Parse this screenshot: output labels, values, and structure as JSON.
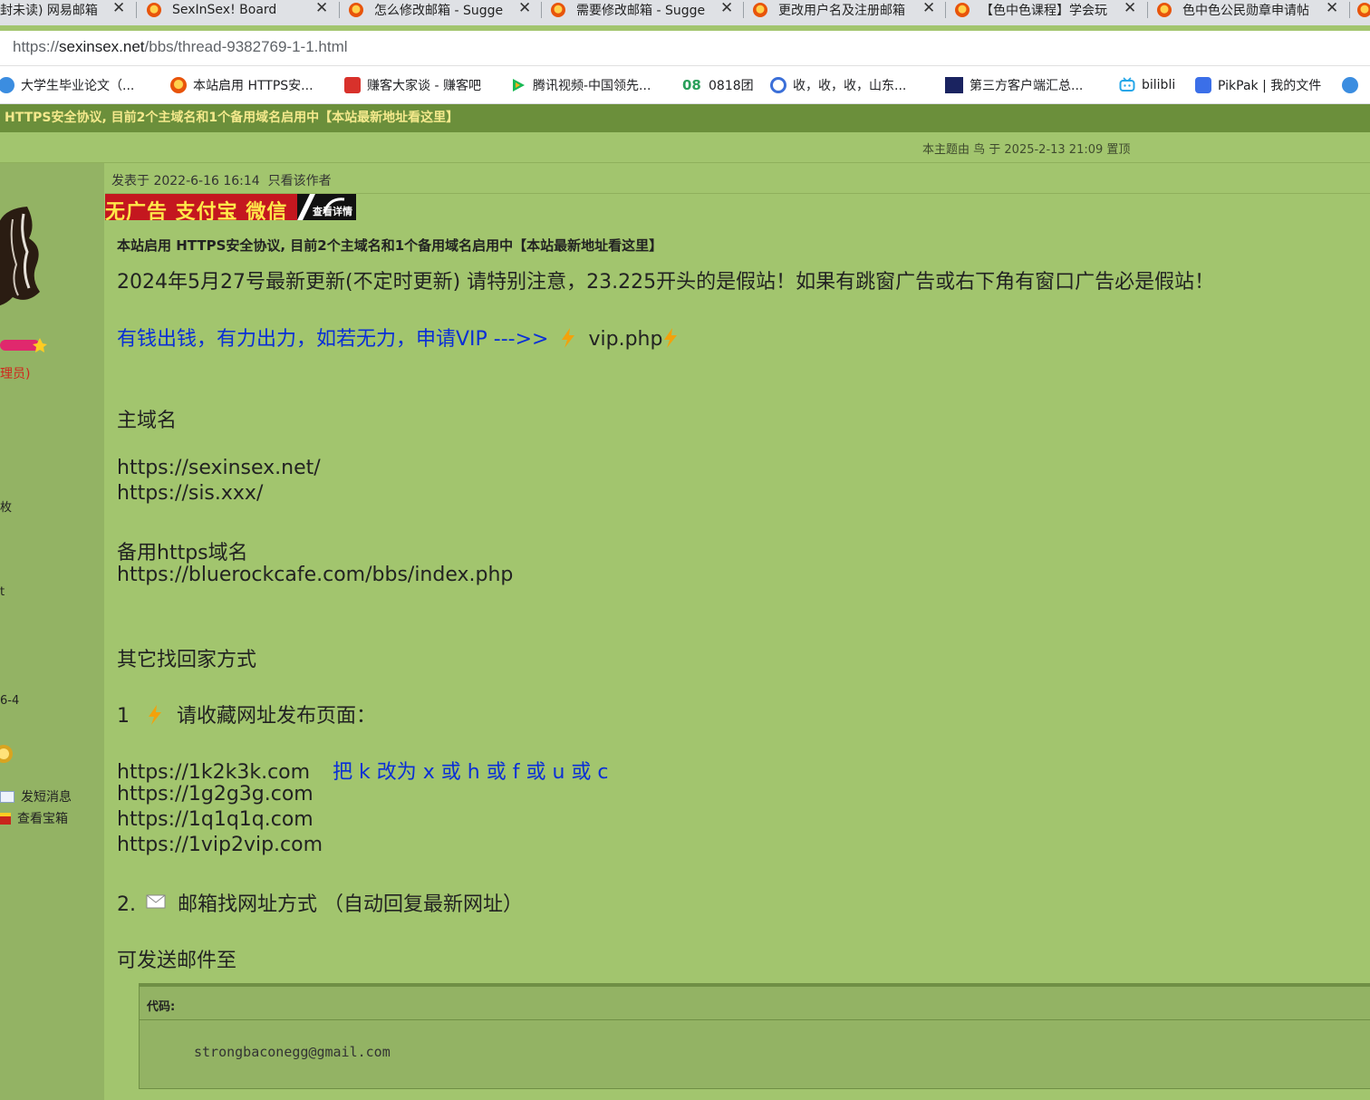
{
  "browser": {
    "tabs": [
      {
        "title": "封未读) 网易邮箱"
      },
      {
        "title": "SexInSex! Board"
      },
      {
        "title": "怎么修改邮箱 - Sugge"
      },
      {
        "title": "需要修改邮箱 - Sugge"
      },
      {
        "title": "更改用户名及注册邮箱"
      },
      {
        "title": "【色中色课程】学会玩"
      },
      {
        "title": "色中色公民勋章申请帖"
      }
    ],
    "tab_close": "✕",
    "url_prefix": "https://",
    "url_host": "sexinsex.net",
    "url_path": "/bbs/thread-9382769-1-1.html",
    "bookmarks": [
      {
        "label": "大学生毕业论文（...",
        "icon": "globe-icon",
        "color": "#3b8de0"
      },
      {
        "label": "本站启用 HTTPS安...",
        "icon": "site-flower-icon",
        "color": "#e8540a"
      },
      {
        "label": "赚客大家谈 - 赚客吧",
        "icon": "zhuanke-icon",
        "color": "#d8312b"
      },
      {
        "label": "腾讯视频-中国领先...",
        "icon": "tencent-video-icon",
        "color": "#19b955"
      },
      {
        "label": "0818团",
        "icon": "tuan-0818-icon",
        "color": "#2aa05b"
      },
      {
        "label": "收，收，收，山东...",
        "icon": "swirl-icon",
        "color": "#3b6fd8"
      },
      {
        "label": "第三方客户端汇总...",
        "icon": "dark-thumb-icon",
        "color": "#1a2360"
      },
      {
        "label": "bilibli",
        "icon": "bilibili-icon",
        "color": "#23a6e8"
      },
      {
        "label": "PikPak | 我的文件",
        "icon": "pikpak-icon",
        "color": "#3b6fe8"
      }
    ]
  },
  "notice": {
    "text": "HTTPS安全协议, 目前2个主域名和1个备用域名启用中【本站最新地址看这里】"
  },
  "thread": {
    "top_note": "本主题由 鸟 于 2025-2-13 21:09 置顶"
  },
  "sidebar": {
    "role": "理员)",
    "frag1": "枚",
    "frag2": "t",
    "frag3": "6-4",
    "send_message": "发短消息",
    "view_treasure": "查看宝箱"
  },
  "post": {
    "meta_posted": "发表于 2022-6-16 16:14",
    "meta_author_only": "只看该作者",
    "ad_text": "无广告 支付宝 微信",
    "ad_tag": "查看详情",
    "title": "本站启用 HTTPS安全协议, 目前2个主域名和1个备用域名启用中【本站最新地址看这里】",
    "update_line": "2024年5月27号最新更新(不定时更新) 请特别注意，23.225开头的是假站！如果有跳窗广告或右下角有窗口广告必是假站！",
    "vip_line": "有钱出钱，有力出力，如若无力，申请VIP --->>",
    "vip_link": "vip.php",
    "main_domain_label": "主域名",
    "main_domains": [
      "https://sexinsex.net/",
      "https://sis.xxx/"
    ],
    "backup_label": "备用https域名",
    "backup_domain": "https://bluerockcafe.com/bbs/index.php",
    "other_ways": "其它找回家方式",
    "item1_num": "1",
    "item1_text": "请收藏网址发布页面：",
    "pub_urls": [
      "https://1k2k3k.com",
      "https://1g2g3g.com",
      "https://1q1q1q.com",
      "https://1vip2vip.com"
    ],
    "pub_hint": "把 k 改为 x 或 h 或 f 或 u 或 c",
    "item2_num": "2.",
    "item2_text": "邮箱找网址方式 （自动回复最新网址）",
    "mail_to": "可发送邮件至",
    "code_label": "代码:",
    "email": "strongbaconegg@gmail.com"
  }
}
